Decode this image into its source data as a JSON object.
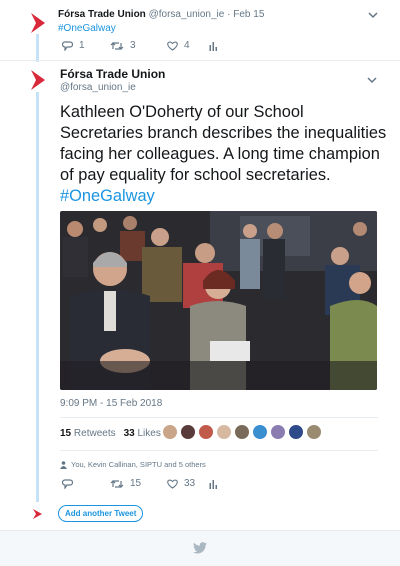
{
  "first_tweet": {
    "name": "Fórsa Trade Union",
    "handle": "@forsa_union_ie",
    "separator": "·",
    "date": "Feb 15",
    "hashtag": "#OneGalway",
    "replies": "1",
    "retweets": "3",
    "likes": "4"
  },
  "main_tweet": {
    "name": "Fórsa Trade Union",
    "handle": "@forsa_union_ie",
    "text": "Kathleen O'Doherty of our School Secretaries branch describes the inequalities facing her colleagues. A long time champion of pay equality for school secretaries. ",
    "hashtag": "#OneGalway",
    "timestamp": "9:09 PM - 15 Feb 2018",
    "retweet_count": "15",
    "retweet_label": "Retweets",
    "like_count": "33",
    "like_label": "Likes",
    "liked_by": "You, Kevin Callinan, SIPTU and 5 others",
    "replies": "",
    "retweets": "15",
    "likes": "33"
  },
  "compose": {
    "add_label": "Add another Tweet"
  },
  "colors": {
    "accent": "#1b95e0",
    "brand_red": "#e0245e",
    "thread_line": "#c4e3f8"
  }
}
